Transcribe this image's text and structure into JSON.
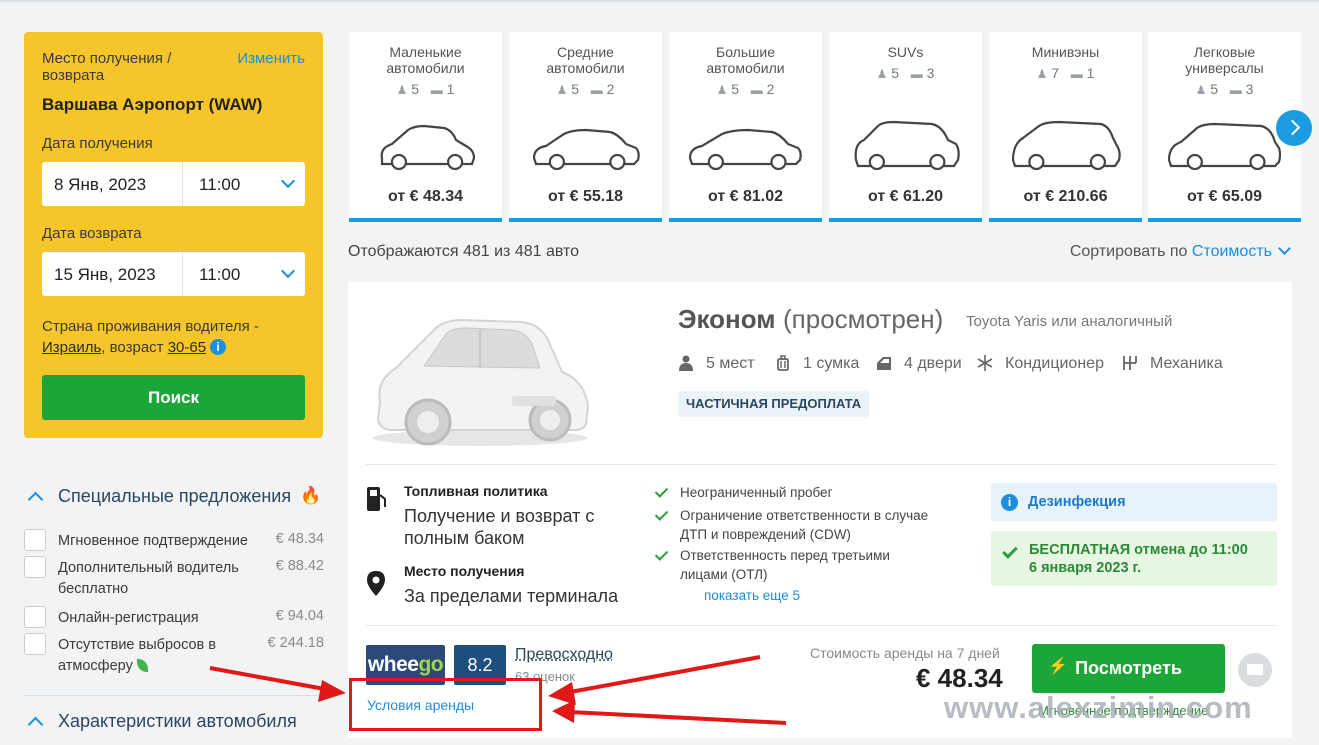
{
  "search": {
    "pickup_label": "Место получения / возврата",
    "change_link": "Изменить",
    "location": "Варшава Аэропорт (WAW)",
    "pickup_date_label": "Дата получения",
    "pickup_date": "8 Янв, 2023",
    "pickup_time": "11:00",
    "return_date_label": "Дата возврата",
    "return_date": "15 Янв, 2023",
    "return_time": "11:00",
    "country_text_1": "Страна проживания водителя -",
    "country": "Израиль",
    "age_text": ", возраст ",
    "age": "30-65",
    "search_button": "Поиск"
  },
  "filters": {
    "special_title": "Специальные предложения",
    "options": [
      {
        "label": "Мгновенное подтверждение",
        "price": "€ 48.34"
      },
      {
        "label": "Дополнительный водитель бесплатно",
        "price": "€ 88.42"
      },
      {
        "label": "Онлайн-регистрация",
        "price": "€ 94.04"
      },
      {
        "label": "Отсутствие выбросов в атмосферу",
        "price": "€ 244.18"
      }
    ],
    "car_specs_title": "Характеристики автомобиля"
  },
  "categories": [
    {
      "name": "Маленькие автомобили",
      "seats": "5",
      "bags": "1",
      "price": "от € 48.34"
    },
    {
      "name": "Средние автомобили",
      "seats": "5",
      "bags": "2",
      "price": "от € 55.18"
    },
    {
      "name": "Большие автомобили",
      "seats": "5",
      "bags": "2",
      "price": "от € 81.02"
    },
    {
      "name": "SUVs",
      "seats": "5",
      "bags": "3",
      "price": "от € 61.20"
    },
    {
      "name": "Минивэны",
      "seats": "7",
      "bags": "1",
      "price": "от € 210.66"
    },
    {
      "name": "Легковые универсалы",
      "seats": "5",
      "bags": "3",
      "price": "от € 65.09"
    }
  ],
  "results": {
    "count_text": "Отображаются 481 из 481 авто",
    "sort_label": "Сортировать по",
    "sort_value": "Стоимость"
  },
  "offer": {
    "class": "Эконом",
    "viewed": "(просмотрен)",
    "model": "Toyota Yaris или аналогичный",
    "specs": [
      "5 мест",
      "1 сумка",
      "4 двери",
      "Кондиционер",
      "Механика"
    ],
    "badge": "ЧАСТИЧНАЯ ПРЕДОПЛАТА",
    "fuel_title": "Топливная политика",
    "fuel_text": "Получение и возврат с полным баком",
    "pickup_title": "Место получения",
    "pickup_text": "За пределами терминала",
    "features": [
      "Неограниченный пробег",
      "Ограничение ответственности в случае ДТП и повреждений (CDW)",
      "Ответственность перед третьими лицами (ОТЛ)"
    ],
    "show_more": "показать еще 5",
    "disinfection": "Дезинфекция",
    "free_cancel_1": "БЕСПЛАТНАЯ отмена до 11:00",
    "free_cancel_2": "6 января 2023 г.",
    "supplier_a": "whee",
    "supplier_b": "go",
    "score": "8.2",
    "rating": "Превосходно",
    "reviews": "63 оценок",
    "terms": "Условия аренды",
    "price_label": "Стоимость аренды на 7 дней",
    "price": "€ 48.34",
    "view_button": "Посмотреть",
    "instant": "Мгновенное подтверждение"
  },
  "watermark": "www.alexzimin.com",
  "colors": {
    "accent": "#1b8ee0",
    "panel": "#f6c52a",
    "cta": "#1da638",
    "annotation": "#e01818"
  }
}
